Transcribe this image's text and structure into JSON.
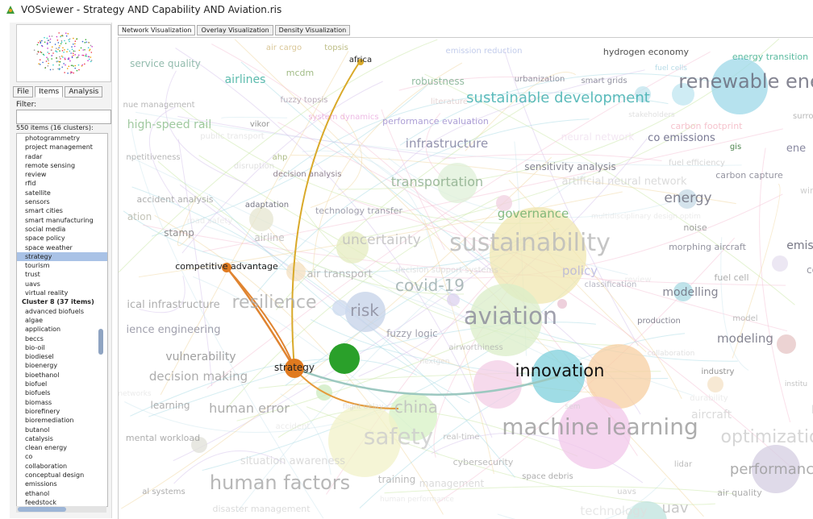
{
  "window": {
    "title": "VOSviewer - Strategy AND Capability AND Aviation.ris"
  },
  "left_panel": {
    "tabs": [
      "File",
      "Items",
      "Analysis"
    ],
    "filter_label": "Filter:",
    "filter_value": "",
    "items_count": "550 items (16 clusters):",
    "items": [
      "photogrammetry",
      "project management",
      "radar",
      "remote sensing",
      "review",
      "rfid",
      "satellite",
      "sensors",
      "smart cities",
      "smart manufacturing",
      "social media",
      "space policy",
      "space weather",
      "strategy",
      "tourism",
      "trust",
      "uavs",
      "virtual reality",
      "Cluster 8 (37 items)",
      "advanced biofuels",
      "algae",
      "application",
      "beccs",
      "bio-oil",
      "biodiesel",
      "bioenergy",
      "bioethanol",
      "biofuel",
      "biofuels",
      "biomass",
      "biorefinery",
      "bioremediation",
      "butanol",
      "catalysis",
      "clean energy",
      "co",
      "collaboration",
      "conceptual design",
      "emissions",
      "ethanol",
      "feedstock"
    ],
    "selected_item": "strategy",
    "header_item": "Cluster 8 (37 items)"
  },
  "view_tabs": [
    "Network Visualization",
    "Overlay Visualization",
    "Density Visualization"
  ],
  "map": {
    "labels": [
      {
        "t": "air cargo"
      },
      {
        "t": "topsis"
      },
      {
        "t": "africa"
      },
      {
        "t": "emission reduction"
      },
      {
        "t": "hydrogen economy"
      },
      {
        "t": "energy transition"
      },
      {
        "t": "service quality"
      },
      {
        "t": "mcdm"
      },
      {
        "t": "airlines"
      },
      {
        "t": "robustness"
      },
      {
        "t": "urbanization"
      },
      {
        "t": "smart grids"
      },
      {
        "t": "fuel cells"
      },
      {
        "t": "renewable ene"
      },
      {
        "t": "fuzzy topsis"
      },
      {
        "t": "nue management"
      },
      {
        "t": "literature"
      },
      {
        "t": "sustainable development"
      },
      {
        "t": "stakeholders"
      },
      {
        "t": "high-speed rail"
      },
      {
        "t": "vikor"
      },
      {
        "t": "system dynamics"
      },
      {
        "t": "performance evaluation"
      },
      {
        "t": "carbon footprint"
      },
      {
        "t": "surroga"
      },
      {
        "t": "public transport"
      },
      {
        "t": "infrastructure"
      },
      {
        "t": "neural network"
      },
      {
        "t": "co emissions"
      },
      {
        "t": "gis"
      },
      {
        "t": "ene"
      },
      {
        "t": "npetitiveness"
      },
      {
        "t": "ahp"
      },
      {
        "t": "disruption"
      },
      {
        "t": "sensitivity analysis"
      },
      {
        "t": "fuel efficiency"
      },
      {
        "t": "decision analysis"
      },
      {
        "t": "carbon capture"
      },
      {
        "t": "transportation"
      },
      {
        "t": "artificial neural network"
      },
      {
        "t": "wind"
      },
      {
        "t": "accident analysis"
      },
      {
        "t": "adaptation"
      },
      {
        "t": "energy"
      },
      {
        "t": "ation"
      },
      {
        "t": "road safety"
      },
      {
        "t": "technology transfer"
      },
      {
        "t": "governance"
      },
      {
        "t": "multidisciplinary design optim"
      },
      {
        "t": "noise"
      },
      {
        "t": "stamp"
      },
      {
        "t": "airline"
      },
      {
        "t": "uncertainty"
      },
      {
        "t": "sustainability"
      },
      {
        "t": "morphing aircraft"
      },
      {
        "t": "emis"
      },
      {
        "t": "competitive advantage"
      },
      {
        "t": "decision support systems"
      },
      {
        "t": "air transport"
      },
      {
        "t": "policy"
      },
      {
        "t": "co"
      },
      {
        "t": "covid-19"
      },
      {
        "t": "review"
      },
      {
        "t": "fuel cell"
      },
      {
        "t": "classification"
      },
      {
        "t": "ical infrastructure"
      },
      {
        "t": "resilience"
      },
      {
        "t": "modelling"
      },
      {
        "t": "risk"
      },
      {
        "t": "aviation"
      },
      {
        "t": "production"
      },
      {
        "t": "model"
      },
      {
        "t": "ience engineering"
      },
      {
        "t": "fuzzy logic"
      },
      {
        "t": "modeling"
      },
      {
        "t": "airworthiness"
      },
      {
        "t": "collaboration"
      },
      {
        "t": "vulnerability"
      },
      {
        "t": "nextgen"
      },
      {
        "t": "strategy"
      },
      {
        "t": "innovation"
      },
      {
        "t": "industry"
      },
      {
        "t": "decision making"
      },
      {
        "t": "institu"
      },
      {
        "t": "networks"
      },
      {
        "t": "durability"
      },
      {
        "t": "learning"
      },
      {
        "t": "human error"
      },
      {
        "t": "flight delay"
      },
      {
        "t": "china"
      },
      {
        "t": "sem"
      },
      {
        "t": "aircraft"
      },
      {
        "t": "pro"
      },
      {
        "t": "accident"
      },
      {
        "t": "mental workload"
      },
      {
        "t": "real-time"
      },
      {
        "t": "safety"
      },
      {
        "t": "machine learning"
      },
      {
        "t": "optimization"
      },
      {
        "t": "situation awareness"
      },
      {
        "t": "cybersecurity"
      },
      {
        "t": "lidar"
      },
      {
        "t": "performanc"
      },
      {
        "t": "training"
      },
      {
        "t": "space debris"
      },
      {
        "t": "al systems"
      },
      {
        "t": "human factors"
      },
      {
        "t": "management"
      },
      {
        "t": "uavs"
      },
      {
        "t": "air quality"
      },
      {
        "t": "disaster management"
      },
      {
        "t": "human performance"
      },
      {
        "t": "technology"
      },
      {
        "t": "uav"
      }
    ]
  }
}
